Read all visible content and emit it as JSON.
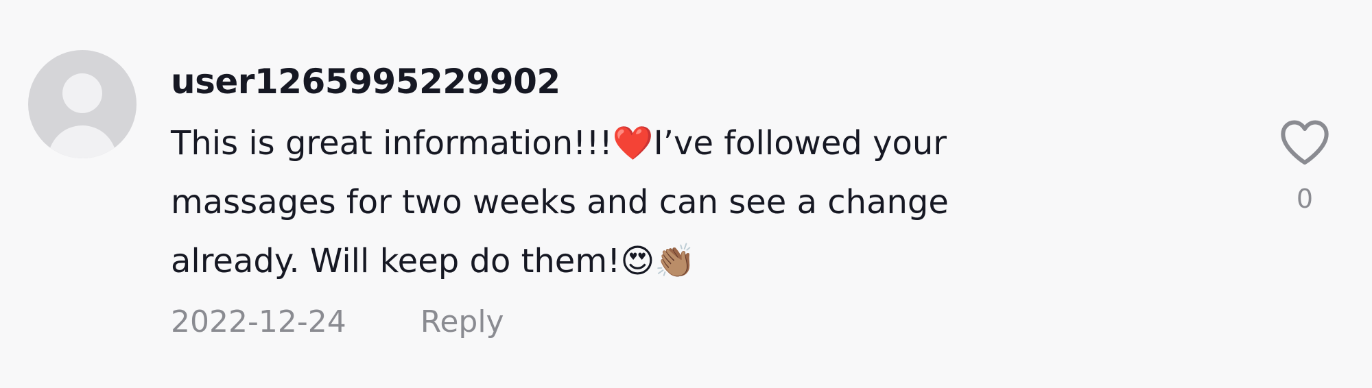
{
  "comment": {
    "username": "user1265995229902",
    "text_lines": [
      "This is great information!!!❤️I’ve followed your",
      "massages for two weeks and can see a change",
      "already. Will keep do them!😍👏🏽"
    ],
    "date": "2022-12-24",
    "reply_label": "Reply",
    "like_count": "0",
    "avatar_icon": "default-user-avatar-icon",
    "like_icon": "heart-outline-icon"
  },
  "colors": {
    "background": "#f8f8f9",
    "text_primary": "#161823",
    "text_secondary": "#8a8b91",
    "avatar_bg": "#d5d5d8"
  }
}
